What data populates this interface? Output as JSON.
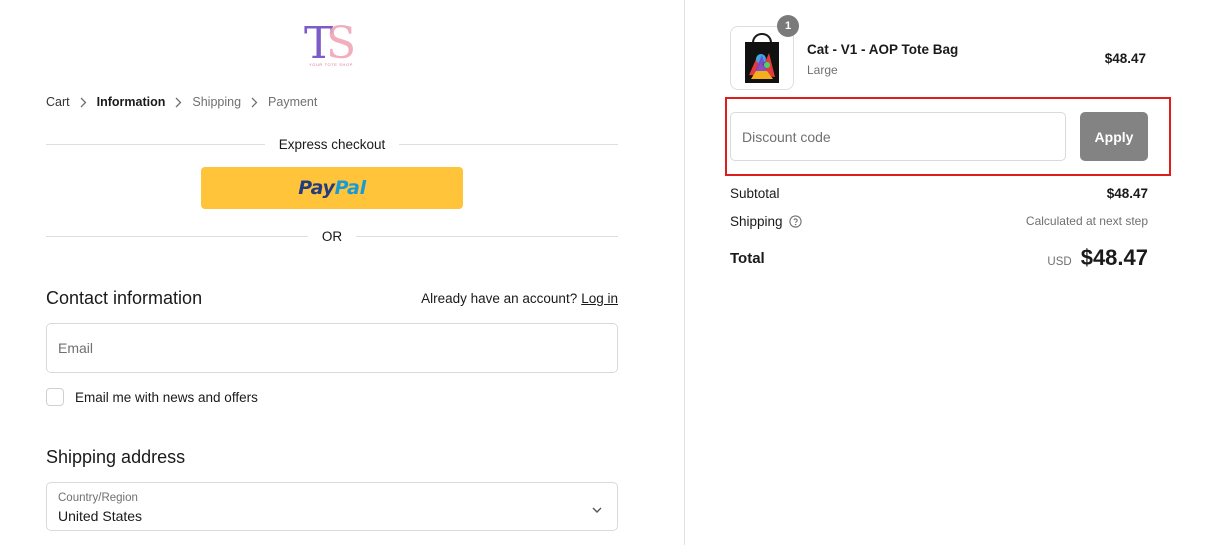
{
  "logo": {
    "initials": "TS",
    "tagline": "YOUR TOTE SHOP"
  },
  "breadcrumb": [
    {
      "label": "Cart",
      "state": "link"
    },
    {
      "label": "Information",
      "state": "current"
    },
    {
      "label": "Shipping",
      "state": "muted"
    },
    {
      "label": "Payment",
      "state": "muted"
    }
  ],
  "express": {
    "title": "Express checkout",
    "paypal_a": "Pay",
    "paypal_b": "Pal",
    "or_label": "OR"
  },
  "contact": {
    "title": "Contact information",
    "account_prompt": "Already have an account?",
    "login_label": "Log in",
    "email_placeholder": "Email",
    "newsletter_label": "Email me with news and offers",
    "newsletter_checked": false
  },
  "shipping_address": {
    "title": "Shipping address",
    "country_label": "Country/Region",
    "country_value": "United States"
  },
  "order": {
    "quantity": "1",
    "product_name": "Cat - V1 - AOP Tote Bag",
    "variant": "Large",
    "price": "$48.47"
  },
  "discount": {
    "placeholder": "Discount code",
    "apply_label": "Apply"
  },
  "summary": {
    "subtotal_label": "Subtotal",
    "subtotal_value": "$48.47",
    "shipping_label": "Shipping",
    "shipping_value": "Calculated at next step",
    "total_label": "Total",
    "currency": "USD",
    "total_value": "$48.47"
  },
  "colors": {
    "paypal_yellow": "#ffc439",
    "paypal_dark": "#253b80",
    "paypal_light": "#179bd7",
    "highlight": "#e01d1d",
    "apply_bg": "#838383",
    "logo_purple": "#7c5cc9",
    "logo_pink": "#f0a7b8"
  }
}
